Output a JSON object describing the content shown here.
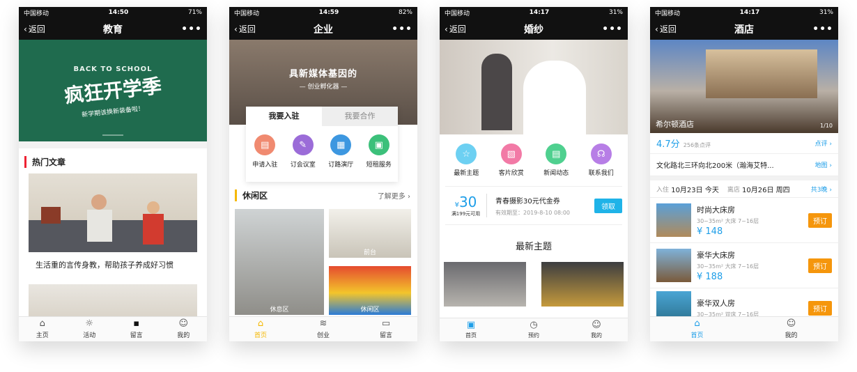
{
  "status_bars": [
    {
      "carrier": "中国移动",
      "time": "14:50",
      "battery": "71%"
    },
    {
      "carrier": "中国移动",
      "time": "14:59",
      "battery": "82%"
    },
    {
      "carrier": "中国移动",
      "time": "14:17",
      "battery": "31%"
    },
    {
      "carrier": "中国移动",
      "time": "14:17",
      "battery": "31%"
    }
  ],
  "common": {
    "back": "返回",
    "more": "•••"
  },
  "edu": {
    "title": "教育",
    "banner_small": "BACK TO SCHOOL",
    "banner_main": "疯狂开学季",
    "banner_sub": "新学期该换新装备啦！",
    "section": "热门文章",
    "article1": "生活重的言传身教，帮助孩子养成好习惯",
    "tabs": [
      "主页",
      "活动",
      "留言",
      "我的"
    ]
  },
  "corp": {
    "title": "企业",
    "banner_main": "具新媒体基因的",
    "banner_sub": "— 创业孵化器 —",
    "tab_active": "我要入驻",
    "tab_other": "我要合作",
    "services": [
      "申请入驻",
      "订会议室",
      "订路演厅",
      "短租服务"
    ],
    "section": "休闲区",
    "more": "了解更多",
    "photos": [
      "休息区",
      "前台",
      "休闲区"
    ],
    "tabs": [
      "首页",
      "创业",
      "留言"
    ]
  },
  "wedding": {
    "title": "婚纱",
    "features": [
      "最新主题",
      "客片欣赏",
      "新闻动态",
      "联系我们"
    ],
    "coupon_price": "30",
    "coupon_currency": "¥",
    "coupon_cond": "满199元可用",
    "coupon_title": "青春摄影30元代金券",
    "coupon_expiry": "有效期至：2019-8-10 08:00",
    "coupon_btn": "领取",
    "section": "最新主题",
    "tabs": [
      "首页",
      "预约",
      "我的"
    ]
  },
  "hotel": {
    "title": "酒店",
    "hotel_name": "希尔顿酒店",
    "photo_counter": "1/10",
    "score": "4.7分",
    "reviews": "256条点评",
    "review_link": "点评",
    "address": "文化路北三环向北200米（瀚海艾特...",
    "map_link": "地图",
    "checkin_label": "入住",
    "checkin": "10月23日 今天",
    "checkout_label": "离店",
    "checkout": "10月26日 周四",
    "nights": "共3晚",
    "rooms": [
      {
        "name": "时尚大床房",
        "detail": "30~35m²  大床  7~16层",
        "price": "¥ 148",
        "btn": "预订"
      },
      {
        "name": "豪华大床房",
        "detail": "30~35m²  大床  7~16层",
        "price": "¥ 188",
        "btn": "预订"
      },
      {
        "name": "豪华双人房",
        "detail": "30~35m²  双床  7~16层",
        "price": "",
        "btn": "预订"
      }
    ],
    "tabs": [
      "首页",
      "我的"
    ]
  },
  "colors": {
    "accent_blue": "#1e9ee8",
    "accent_orange": "#f5960c",
    "accent_red": "#e23",
    "corp_yellow": "#f5b800"
  }
}
